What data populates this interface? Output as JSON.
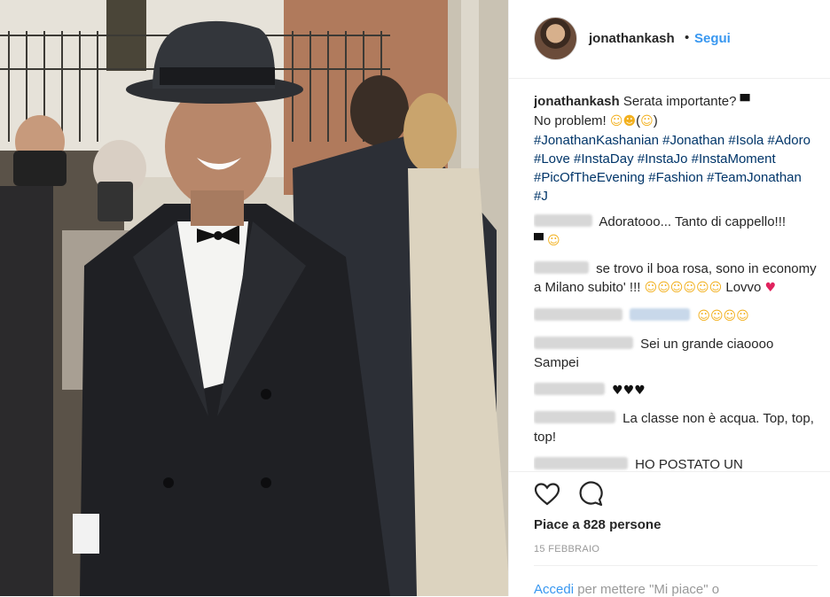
{
  "post": {
    "username": "jonathankash",
    "follow_label": "Segui",
    "separator": "•",
    "caption": {
      "username": "jonathankash",
      "line1": "Serata importante?",
      "line2": "No problem!",
      "hashtags": "#JonathanKashanian #Jonathan #Isola #Adoro #Love #InstaDay #InstaJo #InstaMoment #PicOfTheEvening #Fashion #TeamJonathan #J"
    },
    "comments": [
      {
        "text": "Adoratooo... Tanto di cappello!!!"
      },
      {
        "text": "se trovo il boa rosa, sono in economy a Milano subito' !!!",
        "tail": "Lovvo"
      },
      {
        "text": ""
      },
      {
        "text": "Sei un grande ciaoooo Sampei"
      },
      {
        "text": ""
      },
      {
        "text": "La classe non è acqua. Top, top, top!"
      },
      {
        "text": "HO POSTATO UN"
      }
    ],
    "likes_text": "Piace a 828 persone",
    "date": "15 FEBBRAIO",
    "login_link": "Accedi",
    "login_rest": "per mettere \"Mi piace\" o"
  },
  "icons": {
    "like": "heart-icon",
    "comment": "comment-bubble-icon"
  },
  "colors": {
    "link": "#3897f0",
    "hashtag": "#003569",
    "text": "#262626",
    "muted": "#999999"
  }
}
